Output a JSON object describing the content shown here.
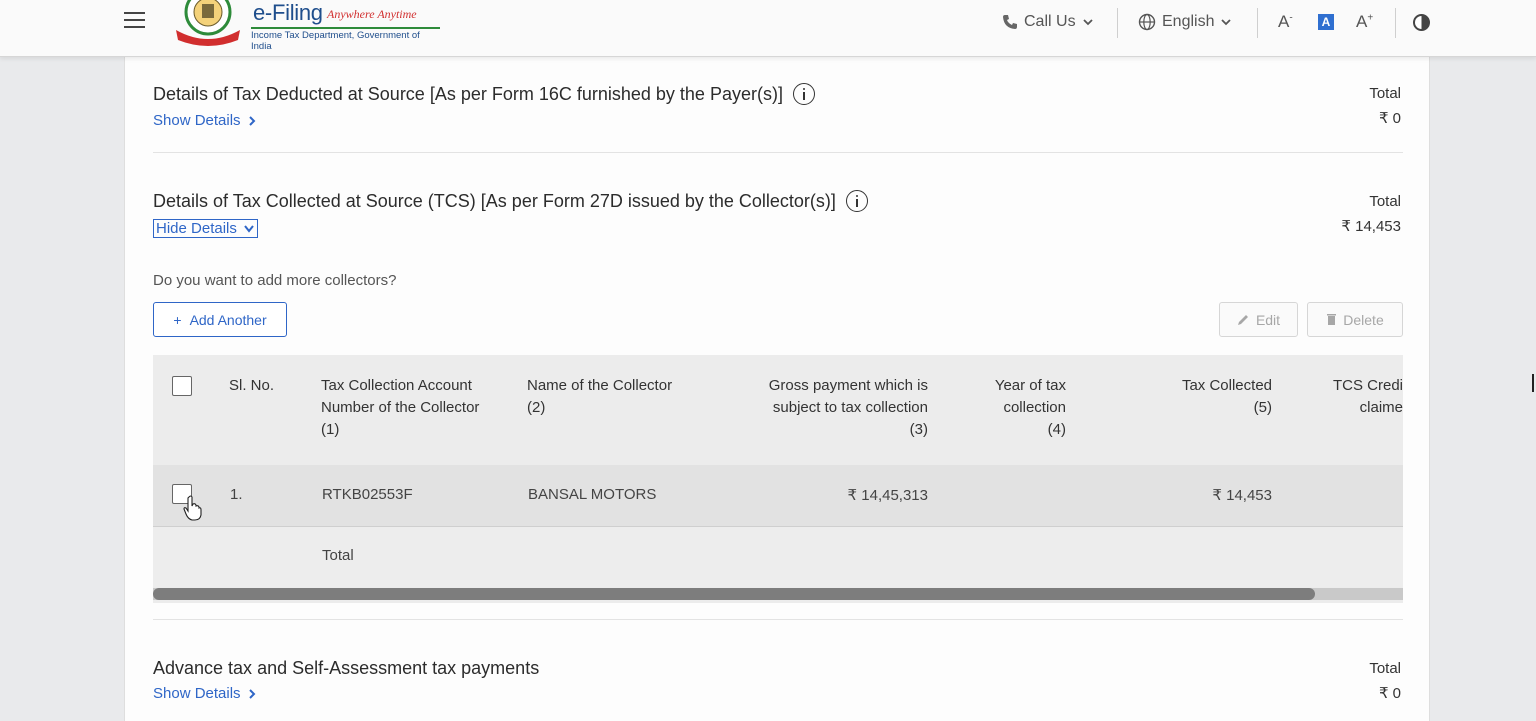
{
  "header": {
    "brand_title": "e-Filing",
    "brand_tagline": "Anywhere Anytime",
    "brand_subtitle": "Income Tax Department, Government of India",
    "call_us": "Call Us",
    "language": "English",
    "font_decrease": "A",
    "font_normal": "A",
    "font_increase": "A"
  },
  "sections": {
    "tds16c": {
      "title": "Details of Tax Deducted at Source [As per Form 16C furnished by the Payer(s)]",
      "toggle": "Show Details",
      "total_label": "Total",
      "total_value": "₹ 0"
    },
    "tcs": {
      "title": "Details of Tax Collected at Source (TCS) [As per Form 27D issued by the Collector(s)]",
      "toggle": "Hide Details",
      "total_label": "Total",
      "total_value": "₹ 14,453",
      "question": "Do you want to add more collectors?",
      "add_button": "Add Another",
      "edit_button": "Edit",
      "delete_button": "Delete",
      "columns": [
        "Sl. No.",
        "Tax Collection Account Number of the Collector (1)",
        "Name of the Collector (2)",
        "Gross payment which is subject to tax collection (3)",
        "Year of tax collection (4)",
        "Tax Collected (5)",
        "TCS Credit claime"
      ],
      "col_headers": {
        "sl": "Sl. No.",
        "tan_l1": "Tax Collection Account",
        "tan_l2": "Number of the Collector",
        "tan_l3": "(1)",
        "name_l1": "Name of the Collector",
        "name_l2": "(2)",
        "gross_l1": "Gross payment which is",
        "gross_l2": "subject to tax collection",
        "gross_l3": "(3)",
        "year_l1": "Year of tax",
        "year_l2": "collection",
        "year_l3": "(4)",
        "taxc_l1": "Tax Collected",
        "taxc_l2": "(5)",
        "tcs_l1": "TCS Credi",
        "tcs_l2": "claime"
      },
      "rows": [
        {
          "sl": "1.",
          "tan": "RTKB02553F",
          "name": "BANSAL MOTORS",
          "gross": "₹ 14,45,313",
          "year": "",
          "tax_collected": "₹ 14,453"
        }
      ],
      "total_row_label": "Total"
    },
    "advance": {
      "title": "Advance tax and Self-Assessment tax payments",
      "toggle": "Show Details",
      "total_label": "Total",
      "total_value": "₹ 0"
    }
  },
  "colors": {
    "link": "#2f66c7",
    "brand_blue": "#1f4e8c",
    "brand_red": "#d12e2e"
  }
}
